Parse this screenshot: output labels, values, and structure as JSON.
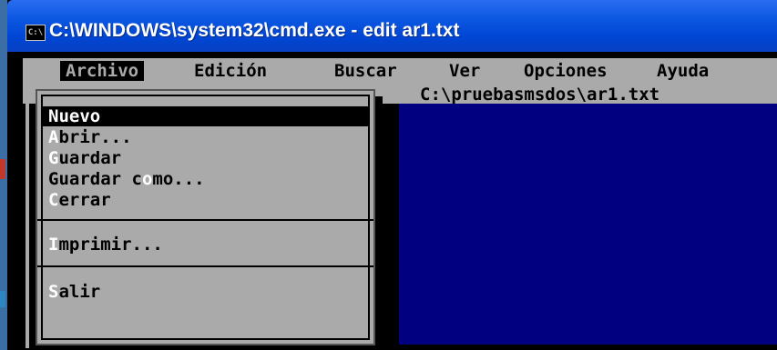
{
  "window": {
    "title": "C:\\WINDOWS\\system32\\cmd.exe - edit ar1.txt",
    "icon": "cmd-icon",
    "icon_text": "C:\\"
  },
  "menubar": {
    "items": [
      {
        "label": "Archivo",
        "active": true
      },
      {
        "label": "Edición"
      },
      {
        "label": "Buscar"
      },
      {
        "label": "Ver"
      },
      {
        "label": "Opciones"
      },
      {
        "label": "Ayuda"
      }
    ]
  },
  "editor": {
    "file_path": "C:\\pruebasmsdos\\ar1.txt"
  },
  "archivo_menu": {
    "items": [
      {
        "hotkey": "N",
        "rest": "uevo",
        "selected": true
      },
      {
        "hotkey": "A",
        "rest": "brir..."
      },
      {
        "hotkey": "G",
        "rest": "uardar"
      },
      {
        "pre": "Guardar c",
        "hotkey": "o",
        "rest": "mo..."
      },
      {
        "hotkey": "C",
        "rest": "errar"
      },
      {
        "hotkey": "I",
        "rest": "mprimir..."
      },
      {
        "hotkey": "S",
        "rest": "alir"
      }
    ]
  },
  "colors": {
    "menubar_bg": "#aaaaaa",
    "editor_bg": "#000080",
    "titlebar_blue": "#0a56e0",
    "hotkey": "#ffffff"
  }
}
